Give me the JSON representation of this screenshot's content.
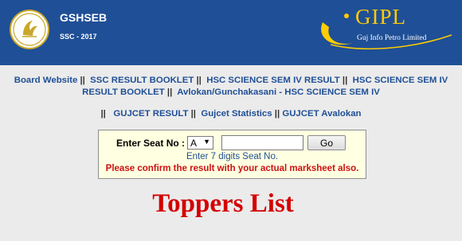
{
  "header": {
    "title": "GSHSEB",
    "subtitle": "SSC - 2017",
    "partner_logo_text": "GIPL",
    "partner_logo_sub": "Guj Info Petro Limited"
  },
  "nav": {
    "links_row1": [
      "Board Website",
      "SSC RESULT BOOKLET",
      "HSC SCIENCE SEM IV RESULT",
      "HSC SCIENCE SEM IV RESULT BOOKLET",
      "Avlokan/Gunchakasani - HSC SCIENCE SEM IV"
    ],
    "links_row2": [
      "GUJCET RESULT",
      "Gujcet Statistics",
      "GUJCET Avalokan"
    ],
    "separator": "||"
  },
  "seat_form": {
    "label": "Enter Seat No :",
    "select_value": "A",
    "input_value": "",
    "go_label": "Go",
    "hint": "Enter 7 digits Seat No.",
    "warning": "Please confirm the result with your actual marksheet also."
  },
  "main": {
    "heading": "Toppers List"
  },
  "colors": {
    "header_bg": "#1f4f96",
    "link": "#1f4f96",
    "warning": "#cc1111",
    "heading": "#d40000",
    "form_bg": "#ffffe1",
    "gipl_gold": "#ffcc00"
  }
}
